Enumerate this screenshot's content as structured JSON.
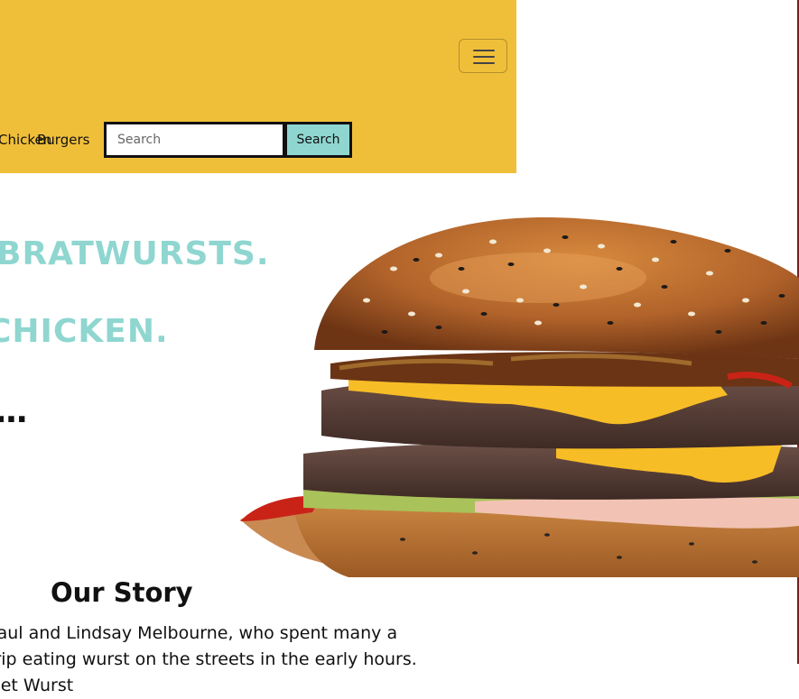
{
  "nav": {
    "links": [
      "Chicken",
      "Burgers"
    ],
    "search_placeholder": "Search",
    "search_button": "Search",
    "menu_icon": "hamburger-menu-icon",
    "background_color": "#f0bf3a"
  },
  "hero": {
    "lines": [
      "BRATWURSTS.",
      "CHICKEN.",
      "..."
    ],
    "image": "burger-image",
    "accent_color": "#8fd6d0"
  },
  "story": {
    "title": "Our Story",
    "text": "Paul and Lindsay Melbourne, who spent many a trip eating wurst on the streets in the early hours. Get Wurst"
  }
}
